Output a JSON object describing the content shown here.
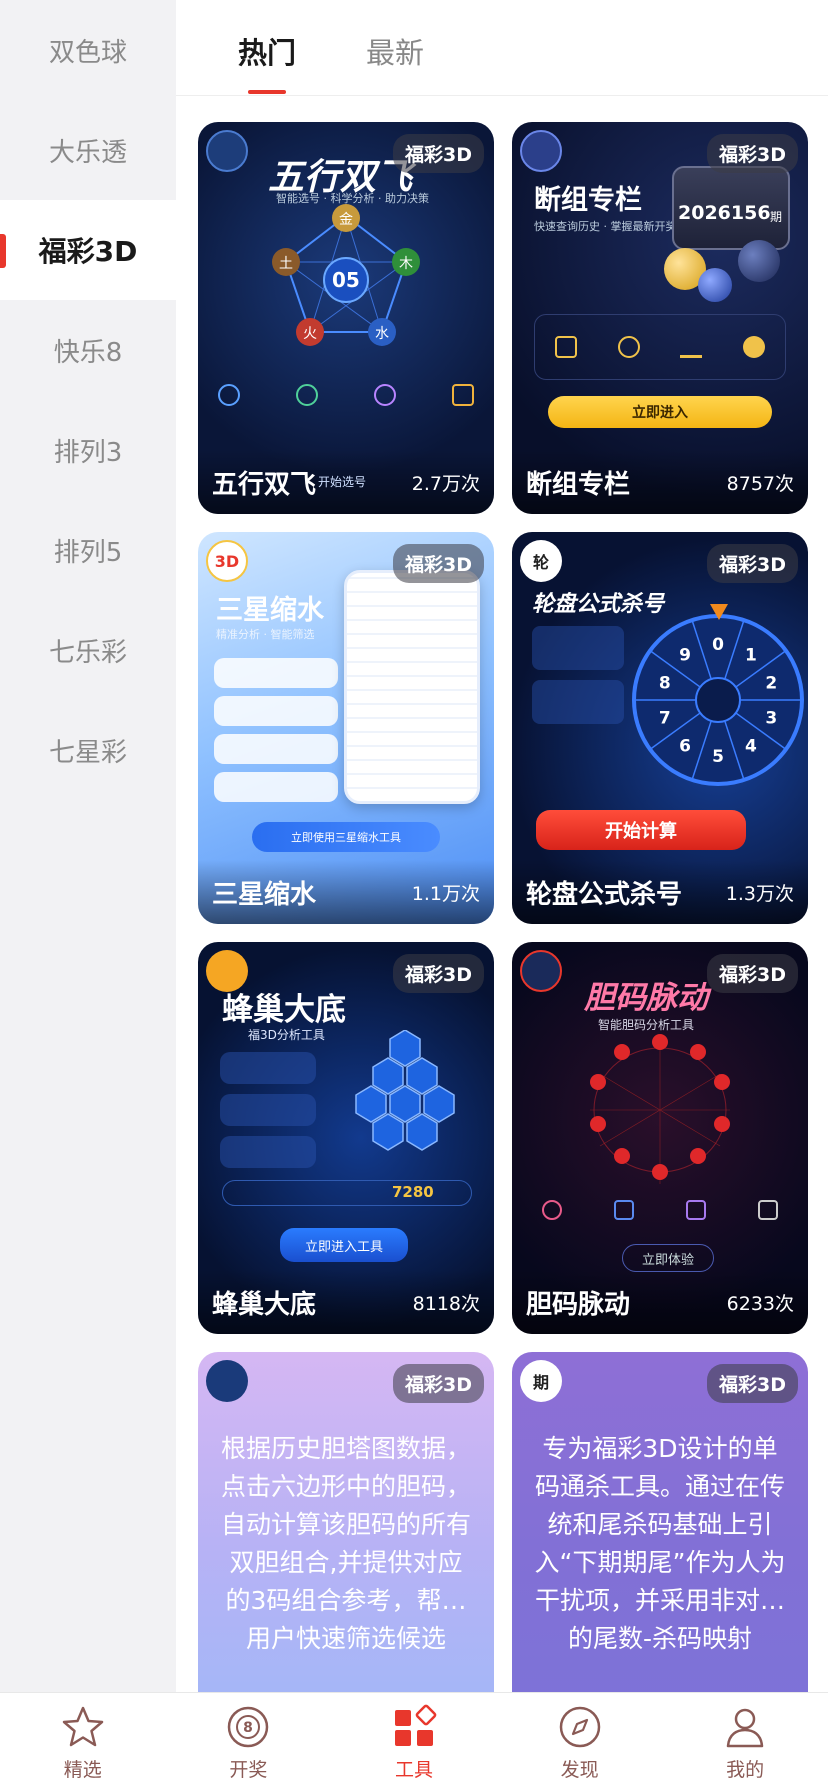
{
  "sidebar": {
    "items": [
      {
        "label": "双色球"
      },
      {
        "label": "大乐透"
      },
      {
        "label": "福彩3D"
      },
      {
        "label": "快乐8"
      },
      {
        "label": "排列3"
      },
      {
        "label": "排列5"
      },
      {
        "label": "七乐彩"
      },
      {
        "label": "七星彩"
      }
    ],
    "active_index": 2
  },
  "tabs": [
    {
      "label": "热门"
    },
    {
      "label": "最新"
    }
  ],
  "cards": [
    {
      "badge": "福彩3D",
      "title": "五行双飞",
      "count": "2.7万次",
      "art_title": "五行双飞",
      "art_sub": "智能选号 · 科学分析 · 助力决策",
      "center_num": "05",
      "elements": [
        "金",
        "木",
        "水",
        "火",
        "土"
      ],
      "cta": "开始选号"
    },
    {
      "badge": "福彩3D",
      "title": "断组专栏",
      "count": "8757次",
      "art_title": "断组专栏",
      "art_sub": "快速查询历史 · 掌握最新开奖",
      "period": "2026156",
      "period_unit": "期",
      "cta": "立即进入"
    },
    {
      "badge": "福彩3D",
      "title": "三星缩水",
      "count": "1.1万次",
      "art_title": "三星缩水",
      "art_sub": "精准分析 · 智能筛选",
      "cta": "立即使用三星缩水工具"
    },
    {
      "badge": "福彩3D",
      "title": "轮盘公式杀号",
      "count": "1.3万次",
      "art_title": "轮盘公式杀号",
      "logo": "轮",
      "cta": "开始计算",
      "wheel_numbers": [
        "0",
        "1",
        "2",
        "3",
        "4",
        "5",
        "6",
        "7",
        "8",
        "9"
      ]
    },
    {
      "badge": "福彩3D",
      "title": "蜂巢大底",
      "count": "8118次",
      "art_title": "蜂巢大底",
      "art_sub": "福3D分析工具",
      "stat_num": "7280",
      "cta": "立即进入工具"
    },
    {
      "badge": "福彩3D",
      "title": "胆码脉动",
      "count": "6233次",
      "art_title": "胆码脉动",
      "art_sub": "智能胆码分析工具",
      "cta": "立即体验"
    },
    {
      "badge": "福彩3D",
      "desc": "根据历史胆塔图数据，点击六边形中的胆码，自动计算该胆码的所有双胆组合,并提供对应的3码组合参考，帮…用户快速筛选候选"
    },
    {
      "badge": "福彩3D",
      "logo": "期",
      "desc": "专为福彩3D设计的单码通杀工具。通过在传统和尾杀码基础上引入“下期期尾”作为人为干扰项，并采用非对…的尾数-杀码映射"
    }
  ],
  "bottom_nav": [
    {
      "label": "精选",
      "icon": "star-icon"
    },
    {
      "label": "开奖",
      "icon": "lottery-ball-icon"
    },
    {
      "label": "工具",
      "icon": "tools-grid-icon"
    },
    {
      "label": "发现",
      "icon": "compass-icon"
    },
    {
      "label": "我的",
      "icon": "user-icon"
    }
  ],
  "active_nav_index": 2,
  "colors": {
    "accent": "#e8372c"
  }
}
